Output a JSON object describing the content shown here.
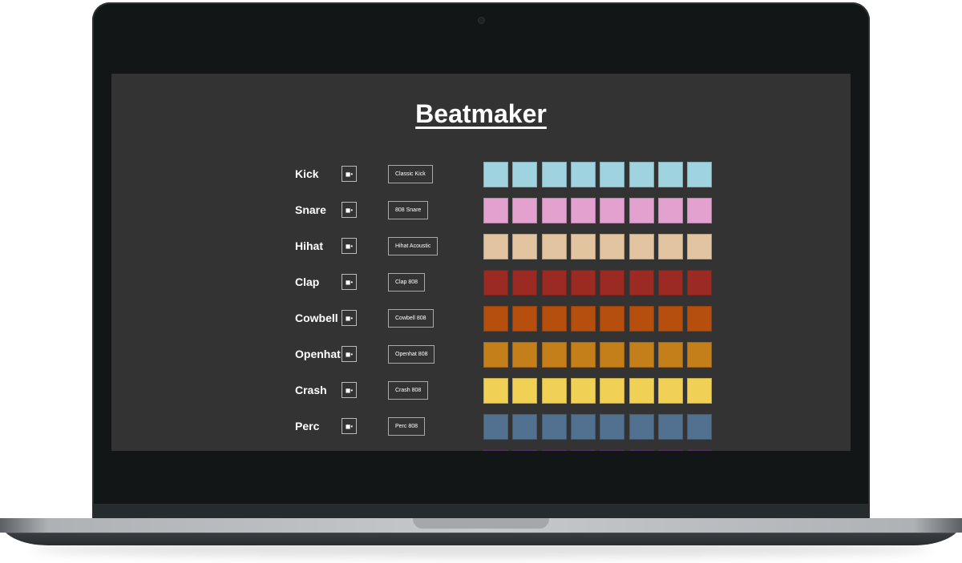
{
  "app": {
    "title": "Beatmaker"
  },
  "icons": {
    "mute": "speaker-icon"
  },
  "tracks": [
    {
      "name": "Kick",
      "sound": "Classic Kick",
      "color": "#9fd3e0",
      "steps": 8
    },
    {
      "name": "Snare",
      "sound": "808 Snare",
      "color": "#e3a1d0",
      "steps": 8
    },
    {
      "name": "Hihat",
      "sound": "Hihat Acoustic",
      "color": "#e3c4a0",
      "steps": 8
    },
    {
      "name": "Clap",
      "sound": "Clap 808",
      "color": "#9b2a22",
      "steps": 8
    },
    {
      "name": "Cowbell",
      "sound": "Cowbell 808",
      "color": "#b64f0e",
      "steps": 8
    },
    {
      "name": "Openhat",
      "sound": "Openhat 808",
      "color": "#c47f1b",
      "steps": 8
    },
    {
      "name": "Crash",
      "sound": "Crash 808",
      "color": "#f0d155",
      "steps": 8
    },
    {
      "name": "Perc",
      "sound": "Perc 808",
      "color": "#52708f",
      "steps": 8
    },
    {
      "name": "",
      "sound": "",
      "color": "#6a3f7a",
      "steps": 8
    }
  ]
}
